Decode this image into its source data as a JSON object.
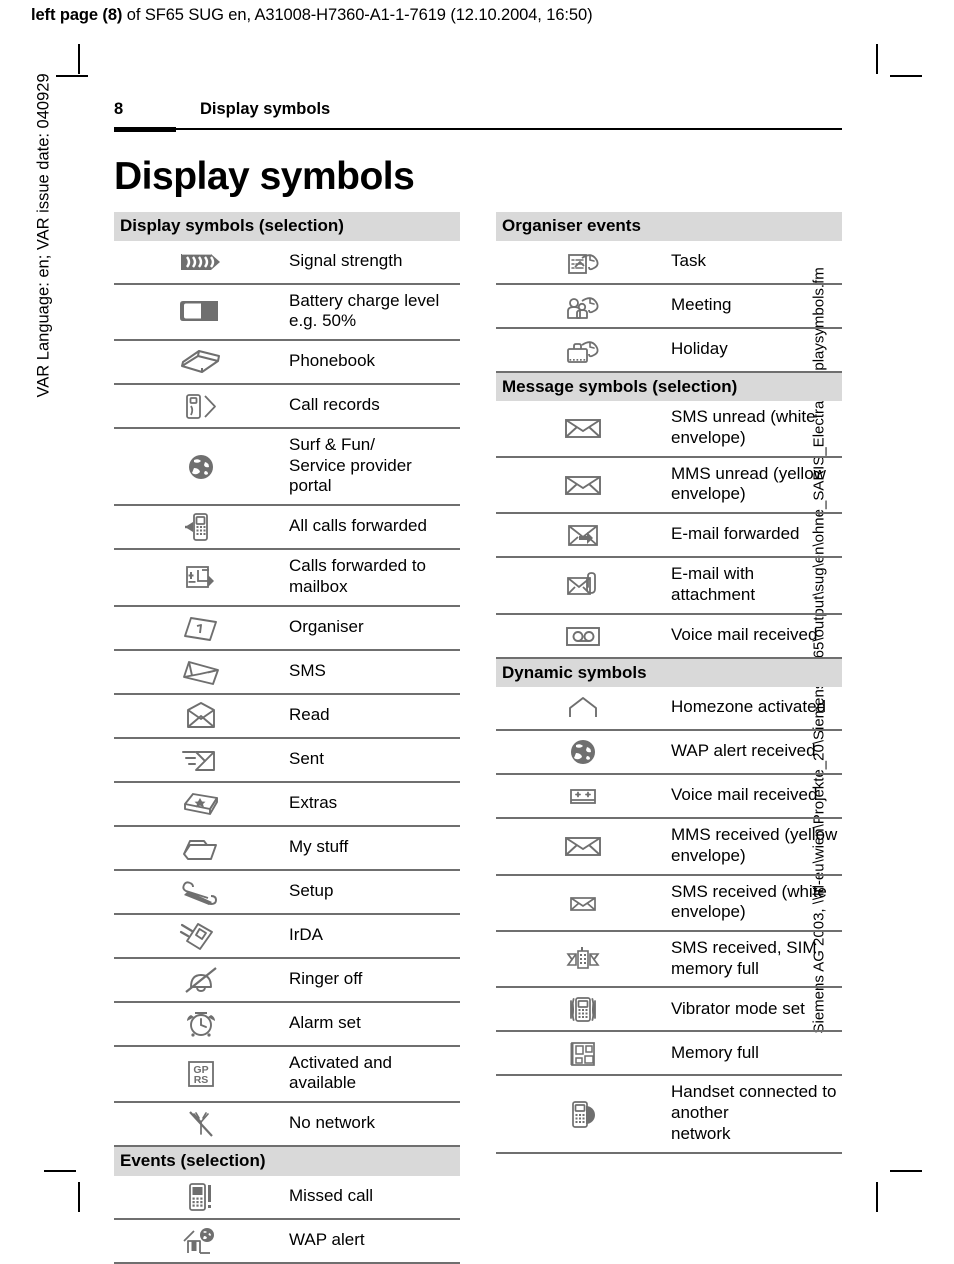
{
  "print_header": {
    "bold_prefix": "left page (8)",
    "rest": " of SF65 SUG en, A31008-H7360-A1-1-7619 (12.10.2004, 16:50)"
  },
  "side_captions": {
    "left": "VAR Language: en; VAR issue date: 040929",
    "right": "Siemens AG 2003, \\\\ltl-eu\\wien\\Projekte_20\\Siemens\\SF65\\output\\sug\\en\\ohne_SARIS_Electra_Displaysymbols.fm"
  },
  "running_head": {
    "page_number": "8",
    "chapter": "Display symbols"
  },
  "title": "Display symbols",
  "colors": {
    "section_header_bg": "#d9d9d9",
    "rule": "#6f6f6f",
    "icon": "#6f6f6f",
    "text": "#000000"
  },
  "left_column": [
    {
      "type": "section",
      "heading": "Display symbols (selection)",
      "items": [
        {
          "icon": "signal-strength-icon",
          "label": "Signal strength"
        },
        {
          "icon": "battery-icon",
          "label": "Battery charge level e.g. 50%"
        },
        {
          "icon": "phonebook-icon",
          "label": "Phonebook"
        },
        {
          "icon": "call-records-icon",
          "label": "Call records"
        },
        {
          "icon": "globe-icon",
          "label": "Surf & Fun/\nService provider portal"
        },
        {
          "icon": "all-calls-forwarded-icon",
          "label": "All calls forwarded"
        },
        {
          "icon": "calls-forwarded-mailbox-icon",
          "label": "Calls forwarded to mailbox"
        },
        {
          "icon": "organiser-icon",
          "label": "Organiser"
        },
        {
          "icon": "sms-icon",
          "label": "SMS"
        },
        {
          "icon": "read-envelope-icon",
          "label": "Read"
        },
        {
          "icon": "sent-envelope-icon",
          "label": "Sent"
        },
        {
          "icon": "extras-box-icon",
          "label": "Extras"
        },
        {
          "icon": "my-stuff-folder-icon",
          "label": "My stuff"
        },
        {
          "icon": "setup-tools-icon",
          "label": "Setup"
        },
        {
          "icon": "irda-icon",
          "label": "IrDA"
        },
        {
          "icon": "ringer-off-icon",
          "label": "Ringer off"
        },
        {
          "icon": "alarm-clock-icon",
          "label": "Alarm set"
        },
        {
          "icon": "gprs-icon",
          "label": "Activated and available"
        },
        {
          "icon": "no-network-icon",
          "label": "No network"
        }
      ]
    },
    {
      "type": "section",
      "heading": "Events (selection)",
      "items": [
        {
          "icon": "missed-call-icon",
          "label": "Missed call"
        },
        {
          "icon": "wap-alert-icon",
          "label": "WAP alert"
        }
      ]
    }
  ],
  "right_column": [
    {
      "type": "section",
      "heading": "Organiser events",
      "items": [
        {
          "icon": "task-icon",
          "label": "Task"
        },
        {
          "icon": "meeting-icon",
          "label": "Meeting"
        },
        {
          "icon": "holiday-icon",
          "label": "Holiday"
        }
      ]
    },
    {
      "type": "section",
      "heading": "Message symbols (selection)",
      "items": [
        {
          "icon": "envelope-closed-icon",
          "label": "SMS unread (white envelope)"
        },
        {
          "icon": "envelope-closed-icon",
          "label": "MMS unread (yellow envelope)"
        },
        {
          "icon": "email-forwarded-icon",
          "label": "E-mail forwarded"
        },
        {
          "icon": "email-attachment-icon",
          "label": "E-mail with attachment"
        },
        {
          "icon": "voice-mail-tape-icon",
          "label": "Voice mail received"
        }
      ]
    },
    {
      "type": "section",
      "heading": "Dynamic symbols",
      "items": [
        {
          "icon": "homezone-icon",
          "label": "Homezone activated"
        },
        {
          "icon": "globe-icon",
          "label": "WAP alert received"
        },
        {
          "icon": "voice-mail-small-icon",
          "label": "Voice mail received"
        },
        {
          "icon": "envelope-closed-icon",
          "label": "MMS received (yellow\nenvelope)"
        },
        {
          "icon": "envelope-small-icon",
          "label": "SMS received (white envelope)"
        },
        {
          "icon": "sms-sim-full-icon",
          "label": "SMS received, SIM memory full"
        },
        {
          "icon": "vibrator-icon",
          "label": "Vibrator mode set"
        },
        {
          "icon": "memory-full-icon",
          "label": "Memory full"
        },
        {
          "icon": "handset-other-network-icon",
          "label": "Handset connected to another\nnetwork"
        }
      ]
    }
  ]
}
